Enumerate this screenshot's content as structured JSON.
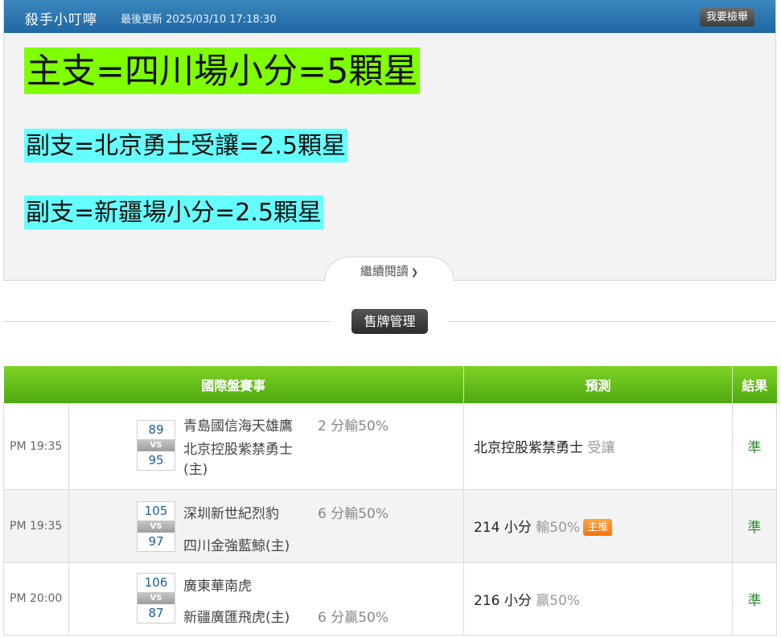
{
  "post": {
    "author": "殺手小叮嚀",
    "updated_label": "最後更新",
    "updated_time": "2025/03/10 17:18:30",
    "report_button": "我要檢舉",
    "picks": {
      "main": "主支=四川場小分=5顆星",
      "sub1": "副支=北京勇士受讓=2.5顆星",
      "sub2": "副支=新疆場小分=2.5顆星"
    },
    "read_more": "繼續閱讀",
    "colors": {
      "header": "#2a78b6",
      "main_highlight": "#7fff00",
      "sub_highlight": "#66ffff"
    }
  },
  "sales_button": "售牌管理",
  "table": {
    "headers": [
      "國際盤賽事",
      "預測",
      "結果"
    ],
    "colors": {
      "header_green": "#5cb815",
      "score_blue": "#1b5d9a",
      "result_green": "#2a8a2a",
      "badge_orange": "#f57a10"
    },
    "rows": [
      {
        "time": "PM 19:35",
        "score_top": "89",
        "vs": "VS",
        "score_bottom": "95",
        "team_top": "青島國信海天雄鷹",
        "team_bottom": "北京控股紫禁勇士(主)",
        "handicap": "2 分輸50%",
        "prediction": "北京控股紫禁勇士",
        "prediction_type": "受讓",
        "badge": "",
        "result": "準"
      },
      {
        "time": "PM 19:35",
        "score_top": "105",
        "vs": "VS",
        "score_bottom": "97",
        "team_top": "深圳新世紀烈豹",
        "team_bottom": "四川金強藍鯨(主)",
        "handicap": "6 分輸50%",
        "prediction": "214 小分",
        "prediction_type": "輸50%",
        "badge": "主推",
        "result": "準"
      },
      {
        "time": "PM 20:00",
        "score_top": "106",
        "vs": "VS",
        "score_bottom": "87",
        "team_top": "廣東華南虎",
        "team_bottom": "新疆廣匯飛虎(主)",
        "handicap": "6 分贏50%",
        "prediction": "216 小分",
        "prediction_type": "贏50%",
        "badge": "",
        "result": "準"
      }
    ]
  }
}
